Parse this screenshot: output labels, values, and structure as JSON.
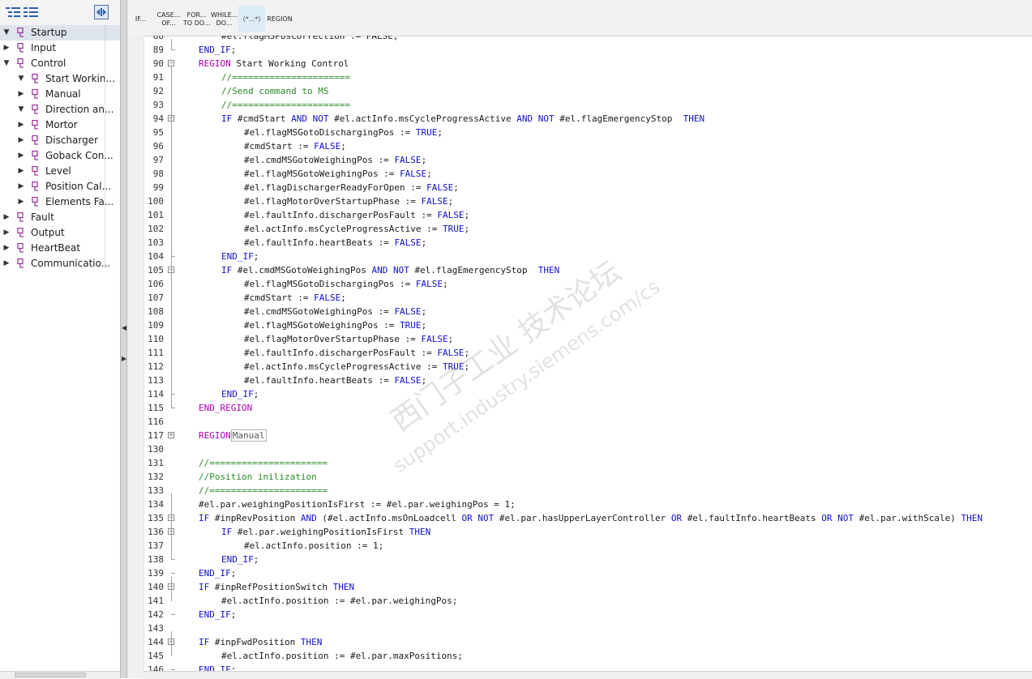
{
  "left_panel": {
    "toolbar": {
      "icons": [
        "expand-all-icon",
        "collapse-all-icon",
        "toggle-panel-icon"
      ]
    },
    "tree": [
      {
        "label": "Startup",
        "level": 0,
        "expanded": true,
        "selected": true
      },
      {
        "label": "Input",
        "level": 0,
        "expanded": false
      },
      {
        "label": "Control",
        "level": 0,
        "expanded": true
      },
      {
        "label": "Start Workin...",
        "level": 1,
        "expanded": true
      },
      {
        "label": "Manual",
        "level": 1,
        "expanded": false
      },
      {
        "label": "Direction an...",
        "level": 1,
        "expanded": true
      },
      {
        "label": "Mortor",
        "level": 1,
        "expanded": false
      },
      {
        "label": "Discharger",
        "level": 1,
        "expanded": false
      },
      {
        "label": "Goback Con...",
        "level": 1,
        "expanded": false
      },
      {
        "label": "Level",
        "level": 1,
        "expanded": false
      },
      {
        "label": "Position Cal...",
        "level": 1,
        "expanded": false
      },
      {
        "label": "Elements Fa...",
        "level": 1,
        "expanded": false
      },
      {
        "label": "Fault",
        "level": 0,
        "expanded": false
      },
      {
        "label": "Output",
        "level": 0,
        "expanded": false
      },
      {
        "label": "HeartBeat",
        "level": 0,
        "expanded": false
      },
      {
        "label": "Communicatio...",
        "level": 0,
        "expanded": false
      }
    ]
  },
  "editor_toolbar": {
    "buttons": [
      {
        "label": "IF...",
        "active": false
      },
      {
        "label": "CASE...\nOF...",
        "active": false
      },
      {
        "label": "FOR...\nTO DO...",
        "active": false
      },
      {
        "label": "WHILE...\nDO...",
        "active": false
      },
      {
        "label": "(*...*)",
        "active": true
      },
      {
        "label": "REGION",
        "active": false
      }
    ]
  },
  "code_lines": [
    {
      "num": "88",
      "indent": 1,
      "fold": "",
      "segs": [
        [
          "v",
          "#el.flagMSPosCorrection := FALSE;"
        ]
      ]
    },
    {
      "num": "89",
      "indent": 0,
      "fold": "end",
      "segs": [
        [
          "k",
          "END_IF"
        ],
        [
          "v",
          ";"
        ]
      ]
    },
    {
      "num": "90",
      "indent": 0,
      "fold": "open",
      "segs": [
        [
          "r",
          "REGION "
        ],
        [
          "v",
          "Start Working Control"
        ]
      ]
    },
    {
      "num": "91",
      "indent": 1,
      "fold": "",
      "segs": [
        [
          "c",
          "//======================"
        ]
      ]
    },
    {
      "num": "92",
      "indent": 1,
      "fold": "",
      "segs": [
        [
          "c",
          "//Send command to MS"
        ]
      ]
    },
    {
      "num": "93",
      "indent": 1,
      "fold": "",
      "segs": [
        [
          "c",
          "//======================"
        ]
      ]
    },
    {
      "num": "94",
      "indent": 1,
      "fold": "open",
      "segs": [
        [
          "k",
          "IF "
        ],
        [
          "v",
          "#cmdStart "
        ],
        [
          "k",
          "AND NOT "
        ],
        [
          "v",
          "#el.actInfo.msCycleProgressActive "
        ],
        [
          "k",
          "AND NOT "
        ],
        [
          "v",
          "#el.flagEmergencyStop  "
        ],
        [
          "k",
          "THEN"
        ]
      ]
    },
    {
      "num": "95",
      "indent": 2,
      "fold": "",
      "segs": [
        [
          "v",
          "#el.flagMSGotoDischargingPos := "
        ],
        [
          "k",
          "TRUE"
        ],
        [
          "v",
          ";"
        ]
      ]
    },
    {
      "num": "96",
      "indent": 2,
      "fold": "",
      "segs": [
        [
          "v",
          "#cmdStart := "
        ],
        [
          "k",
          "FALSE"
        ],
        [
          "v",
          ";"
        ]
      ]
    },
    {
      "num": "97",
      "indent": 2,
      "fold": "",
      "segs": [
        [
          "v",
          "#el.cmdMSGotoWeighingPos := "
        ],
        [
          "k",
          "FALSE"
        ],
        [
          "v",
          ";"
        ]
      ]
    },
    {
      "num": "98",
      "indent": 2,
      "fold": "",
      "segs": [
        [
          "v",
          "#el.flagMSGotoWeighingPos := "
        ],
        [
          "k",
          "FALSE"
        ],
        [
          "v",
          ";"
        ]
      ]
    },
    {
      "num": "99",
      "indent": 2,
      "fold": "",
      "segs": [
        [
          "v",
          "#el.flagDischargerReadyForOpen := "
        ],
        [
          "k",
          "FALSE"
        ],
        [
          "v",
          ";"
        ]
      ]
    },
    {
      "num": "100",
      "indent": 2,
      "fold": "",
      "segs": [
        [
          "v",
          "#el.flagMotorOverStartupPhase := "
        ],
        [
          "k",
          "FALSE"
        ],
        [
          "v",
          ";"
        ]
      ]
    },
    {
      "num": "101",
      "indent": 2,
      "fold": "",
      "segs": [
        [
          "v",
          "#el.faultInfo.dischargerPosFault := "
        ],
        [
          "k",
          "FALSE"
        ],
        [
          "v",
          ";"
        ]
      ]
    },
    {
      "num": "102",
      "indent": 2,
      "fold": "",
      "segs": [
        [
          "v",
          "#el.actInfo.msCycleProgressActive := "
        ],
        [
          "k",
          "TRUE"
        ],
        [
          "v",
          ";"
        ]
      ]
    },
    {
      "num": "103",
      "indent": 2,
      "fold": "",
      "segs": [
        [
          "v",
          "#el.faultInfo.heartBeats := "
        ],
        [
          "k",
          "FALSE"
        ],
        [
          "v",
          ";"
        ]
      ]
    },
    {
      "num": "104",
      "indent": 1,
      "fold": "end",
      "segs": [
        [
          "k",
          "END_IF"
        ],
        [
          "v",
          ";"
        ]
      ]
    },
    {
      "num": "105",
      "indent": 1,
      "fold": "open",
      "segs": [
        [
          "k",
          "IF "
        ],
        [
          "v",
          "#el.cmdMSGotoWeighingPos "
        ],
        [
          "k",
          "AND NOT "
        ],
        [
          "v",
          "#el.flagEmergencyStop  "
        ],
        [
          "k",
          "THEN"
        ]
      ]
    },
    {
      "num": "106",
      "indent": 2,
      "fold": "",
      "segs": [
        [
          "v",
          "#el.flagMSGotoDischargingPos := "
        ],
        [
          "k",
          "FALSE"
        ],
        [
          "v",
          ";"
        ]
      ]
    },
    {
      "num": "107",
      "indent": 2,
      "fold": "",
      "segs": [
        [
          "v",
          "#cmdStart := "
        ],
        [
          "k",
          "FALSE"
        ],
        [
          "v",
          ";"
        ]
      ]
    },
    {
      "num": "108",
      "indent": 2,
      "fold": "",
      "segs": [
        [
          "v",
          "#el.cmdMSGotoWeighingPos := "
        ],
        [
          "k",
          "FALSE"
        ],
        [
          "v",
          ";"
        ]
      ]
    },
    {
      "num": "109",
      "indent": 2,
      "fold": "",
      "segs": [
        [
          "v",
          "#el.flagMSGotoWeighingPos := "
        ],
        [
          "k",
          "TRUE"
        ],
        [
          "v",
          ";"
        ]
      ]
    },
    {
      "num": "110",
      "indent": 2,
      "fold": "",
      "segs": [
        [
          "v",
          "#el.flagMotorOverStartupPhase := "
        ],
        [
          "k",
          "FALSE"
        ],
        [
          "v",
          ";"
        ]
      ]
    },
    {
      "num": "111",
      "indent": 2,
      "fold": "",
      "segs": [
        [
          "v",
          "#el.faultInfo.dischargerPosFault := "
        ],
        [
          "k",
          "FALSE"
        ],
        [
          "v",
          ";"
        ]
      ]
    },
    {
      "num": "112",
      "indent": 2,
      "fold": "",
      "segs": [
        [
          "v",
          "#el.actInfo.msCycleProgressActive := "
        ],
        [
          "k",
          "TRUE"
        ],
        [
          "v",
          ";"
        ]
      ]
    },
    {
      "num": "113",
      "indent": 2,
      "fold": "",
      "segs": [
        [
          "v",
          "#el.faultInfo.heartBeats := "
        ],
        [
          "k",
          "FALSE"
        ],
        [
          "v",
          ";"
        ]
      ]
    },
    {
      "num": "114",
      "indent": 1,
      "fold": "end",
      "segs": [
        [
          "k",
          "END_IF"
        ],
        [
          "v",
          ";"
        ]
      ]
    },
    {
      "num": "115",
      "indent": 0,
      "fold": "end",
      "segs": [
        [
          "r",
          "END_REGION"
        ]
      ]
    },
    {
      "num": "116",
      "indent": 0,
      "fold": "",
      "segs": []
    },
    {
      "num": "117",
      "indent": 0,
      "fold": "closed",
      "segs": [
        [
          "r",
          "REGION"
        ],
        [
          "box",
          "Manual"
        ]
      ]
    },
    {
      "num": "130",
      "indent": 0,
      "fold": "",
      "segs": []
    },
    {
      "num": "131",
      "indent": 0,
      "fold": "",
      "segs": [
        [
          "c",
          "//======================"
        ]
      ]
    },
    {
      "num": "132",
      "indent": 0,
      "fold": "",
      "segs": [
        [
          "c",
          "//Position inilization"
        ]
      ]
    },
    {
      "num": "133",
      "indent": 0,
      "fold": "",
      "segs": [
        [
          "c",
          "//======================"
        ]
      ]
    },
    {
      "num": "134",
      "indent": 0,
      "fold": "",
      "segs": [
        [
          "v",
          "#el.par.weighingPositionIsFirst := #el.par.weighingPos = 1;"
        ]
      ]
    },
    {
      "num": "135",
      "indent": 0,
      "fold": "open",
      "segs": [
        [
          "k",
          "IF "
        ],
        [
          "v",
          "#inpRevPosition "
        ],
        [
          "k",
          "AND "
        ],
        [
          "v",
          "(#el.actInfo.msOnLoadcell "
        ],
        [
          "k",
          "OR NOT "
        ],
        [
          "v",
          "#el.par.hasUpperLayerController "
        ],
        [
          "k",
          "OR "
        ],
        [
          "v",
          "#el.faultInfo.heartBeats "
        ],
        [
          "k",
          "OR NOT "
        ],
        [
          "v",
          "#el.par.withScale) "
        ],
        [
          "k",
          "THEN"
        ]
      ]
    },
    {
      "num": "136",
      "indent": 1,
      "fold": "open",
      "segs": [
        [
          "k",
          "IF "
        ],
        [
          "v",
          "#el.par.weighingPositionIsFirst "
        ],
        [
          "k",
          "THEN"
        ]
      ]
    },
    {
      "num": "137",
      "indent": 2,
      "fold": "",
      "segs": [
        [
          "v",
          "#el.actInfo.position := 1;"
        ]
      ]
    },
    {
      "num": "138",
      "indent": 1,
      "fold": "end",
      "segs": [
        [
          "k",
          "END_IF"
        ],
        [
          "v",
          ";"
        ]
      ]
    },
    {
      "num": "139",
      "indent": 0,
      "fold": "end",
      "segs": [
        [
          "k",
          "END_IF"
        ],
        [
          "v",
          ";"
        ]
      ]
    },
    {
      "num": "140",
      "indent": 0,
      "fold": "open",
      "segs": [
        [
          "k",
          "IF "
        ],
        [
          "v",
          "#inpRefPositionSwitch "
        ],
        [
          "k",
          "THEN"
        ]
      ]
    },
    {
      "num": "141",
      "indent": 1,
      "fold": "",
      "segs": [
        [
          "v",
          "#el.actInfo.position := #el.par.weighingPos;"
        ]
      ]
    },
    {
      "num": "142",
      "indent": 0,
      "fold": "end",
      "segs": [
        [
          "k",
          "END_IF"
        ],
        [
          "v",
          ";"
        ]
      ]
    },
    {
      "num": "143",
      "indent": 0,
      "fold": "",
      "segs": []
    },
    {
      "num": "144",
      "indent": 0,
      "fold": "open",
      "segs": [
        [
          "k",
          "IF "
        ],
        [
          "v",
          "#inpFwdPosition "
        ],
        [
          "k",
          "THEN"
        ]
      ]
    },
    {
      "num": "145",
      "indent": 1,
      "fold": "",
      "segs": [
        [
          "v",
          "#el.actInfo.position := #el.par.maxPositions;"
        ]
      ]
    },
    {
      "num": "146",
      "indent": 0,
      "fold": "end",
      "segs": [
        [
          "k",
          "END_IF"
        ],
        [
          "v",
          ";"
        ]
      ]
    }
  ],
  "watermark": {
    "line1": "西门子工业 技术论坛",
    "line2": "support.industry.siemens.com/cs"
  },
  "colors": {
    "keyword": "#1010c8",
    "region": "#b000b0",
    "comment": "#2a8a2a",
    "selected_tree": "#dde4ec"
  }
}
